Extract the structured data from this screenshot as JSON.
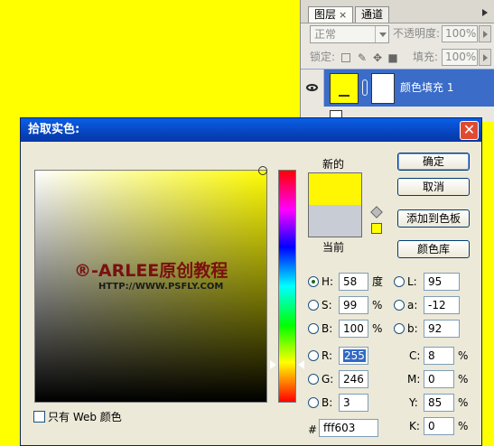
{
  "layers_panel": {
    "tabs": [
      {
        "label": "图层",
        "close": "×"
      },
      {
        "label": "通道"
      }
    ],
    "blend_mode": "正常",
    "opacity_label": "不透明度:",
    "opacity_value": "100%",
    "lock_label": "锁定:",
    "fill_label": "填充:",
    "fill_value": "100%",
    "layer_name": "颜色填充 1"
  },
  "dialog": {
    "title": "拾取实色:",
    "close_glyph": "✕",
    "new_label": "新的",
    "current_label": "当前",
    "buttons": {
      "ok": "确定",
      "cancel": "取消",
      "add_to_swatches": "添加到色板",
      "color_libraries": "颜色库"
    },
    "hsb": [
      {
        "label": "H:",
        "value": "58",
        "unit": "度"
      },
      {
        "label": "S:",
        "value": "99",
        "unit": "%"
      },
      {
        "label": "B:",
        "value": "100",
        "unit": "%"
      }
    ],
    "rgb": [
      {
        "label": "R:",
        "value": "255"
      },
      {
        "label": "G:",
        "value": "246"
      },
      {
        "label": "B:",
        "value": "3"
      }
    ],
    "lab": [
      {
        "label": "L:",
        "value": "95"
      },
      {
        "label": "a:",
        "value": "-12"
      },
      {
        "label": "b:",
        "value": "92"
      }
    ],
    "cmyk": [
      {
        "label": "C:",
        "value": "8",
        "unit": "%"
      },
      {
        "label": "M:",
        "value": "0",
        "unit": "%"
      },
      {
        "label": "Y:",
        "value": "85",
        "unit": "%"
      },
      {
        "label": "K:",
        "value": "0",
        "unit": "%"
      }
    ],
    "hex_label": "#",
    "hex_value": "fff603",
    "web_only_label": "只有 Web 颜色",
    "watermark": "®-ARLEE原创教程",
    "watermark_url": "HTTP://WWW.PSFLY.COM"
  },
  "colors": {
    "new_color": "#fff603",
    "current_color": "#c8ccd4",
    "background": "#ffff00"
  }
}
